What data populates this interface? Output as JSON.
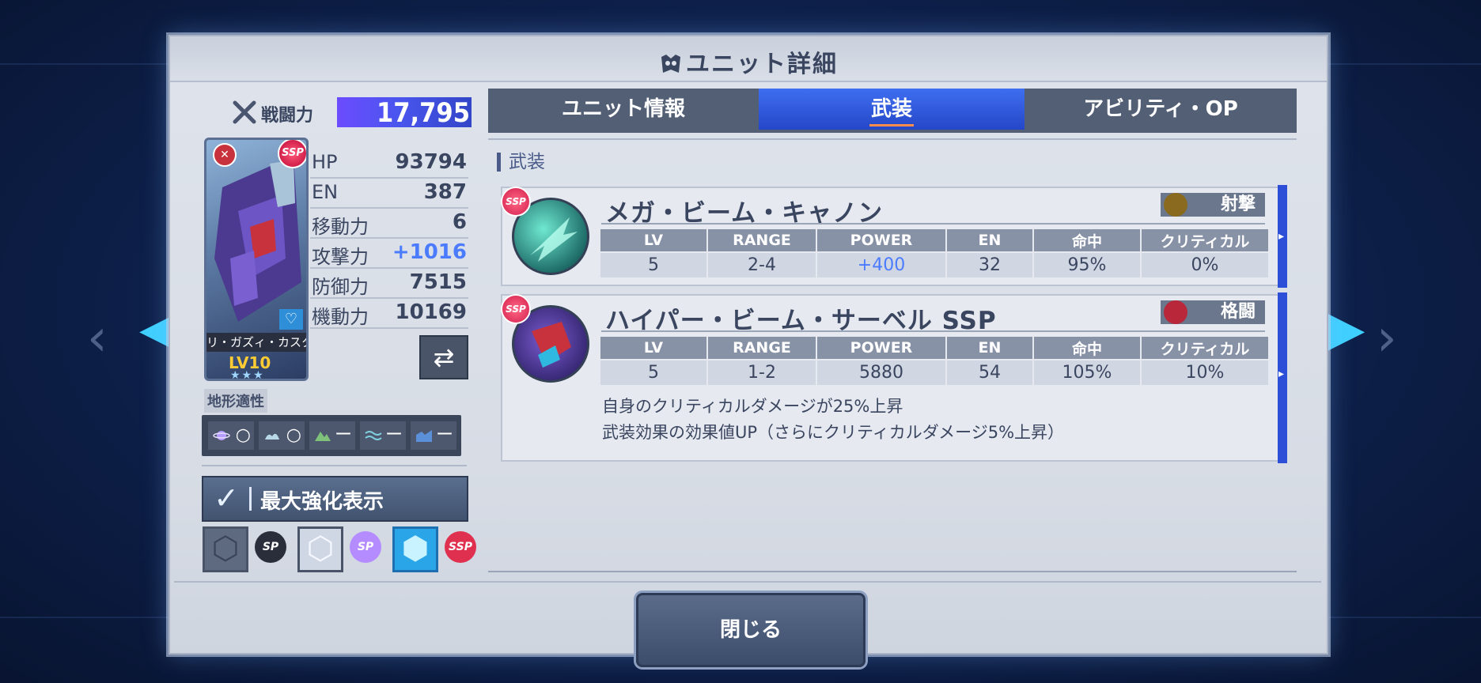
{
  "title": "ユニット詳細",
  "combat_power": {
    "label": "戦闘力",
    "value": "17,795"
  },
  "unit_card": {
    "name": "リ・ガズィ・カスタム",
    "level": "LV10",
    "stars": "★★★",
    "rarity": "SSP"
  },
  "stats": [
    {
      "label": "HP",
      "value": "93794"
    },
    {
      "label": "EN",
      "value": "387"
    },
    {
      "label": "移動力",
      "value": "6"
    },
    {
      "label": "攻撃力",
      "value": "+1016",
      "boosted": true
    },
    {
      "label": "防御力",
      "value": "7515"
    },
    {
      "label": "機動力",
      "value": "10169"
    }
  ],
  "terrain": {
    "title": "地形適性",
    "cells": [
      {
        "icon": "space-icon",
        "rating": "○"
      },
      {
        "icon": "air-icon",
        "rating": "○"
      },
      {
        "icon": "ground-icon",
        "rating": "ー"
      },
      {
        "icon": "sea-icon",
        "rating": "ー"
      },
      {
        "icon": "underwater-icon",
        "rating": "ー"
      }
    ]
  },
  "max_upgrade": {
    "label": "最大強化表示",
    "checked": true
  },
  "rank_buttons": [
    {
      "tag": "SP",
      "state": "dark"
    },
    {
      "tag": "SP",
      "state": "light"
    },
    {
      "tag": "SSP",
      "state": "active"
    }
  ],
  "tabs": [
    {
      "label": "ユニット情報",
      "active": false
    },
    {
      "label": "武装",
      "active": true
    },
    {
      "label": "アビリティ・OP",
      "active": false
    }
  ],
  "section_title": "武装",
  "weapon_headers": [
    "LV",
    "RANGE",
    "POWER",
    "EN",
    "命中",
    "クリティカル"
  ],
  "weapons": [
    {
      "name": "メガ・ビーム・キャノン",
      "type": "射撃",
      "rarity": "SSP",
      "values": [
        "5",
        "2-4",
        "+400",
        "32",
        "95%",
        "0%"
      ],
      "effects": []
    },
    {
      "name": "ハイパー・ビーム・サーベル SSP",
      "type": "格闘",
      "rarity": "SSP",
      "values": [
        "5",
        "1-2",
        "5880",
        "54",
        "105%",
        "10%"
      ],
      "effects": [
        "自身のクリティカルダメージが25%上昇",
        "武装効果の効果値UP（さらにクリティカルダメージ5%上昇）"
      ]
    }
  ],
  "close_label": "閉じる",
  "colors": {
    "accent": "#2447c8",
    "boost": "#4b7bff",
    "frame": "#dfe4ec"
  }
}
